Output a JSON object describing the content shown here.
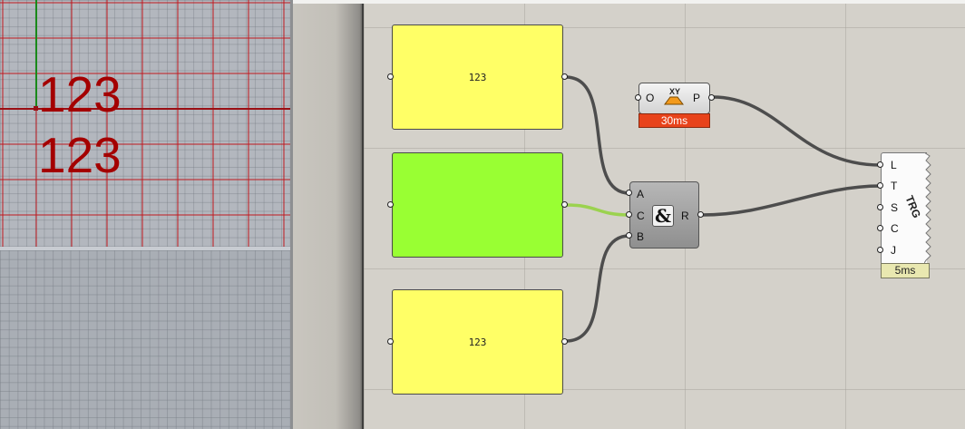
{
  "viewport": {
    "texts": [
      "123",
      "123"
    ]
  },
  "canvas": {
    "panels": [
      {
        "text": "123",
        "color": "#ffff66"
      },
      {
        "text": "",
        "color": "#99ff33"
      },
      {
        "text": "123",
        "color": "#ffff66"
      }
    ],
    "xy_component": {
      "input": "O",
      "output": "P",
      "icon": "xy-plane-icon",
      "time": "30ms"
    },
    "and_component": {
      "inputs": [
        "A",
        "C",
        "B"
      ],
      "output": "R",
      "icon": "&"
    },
    "trigger_component": {
      "inputs": [
        "L",
        "T",
        "S",
        "C",
        "J"
      ],
      "title": "TRG",
      "time": "5ms"
    }
  },
  "colors": {
    "wire": "#4d4d4d",
    "wire_green": "#9bd24f",
    "viewport_text": "#a40000"
  }
}
